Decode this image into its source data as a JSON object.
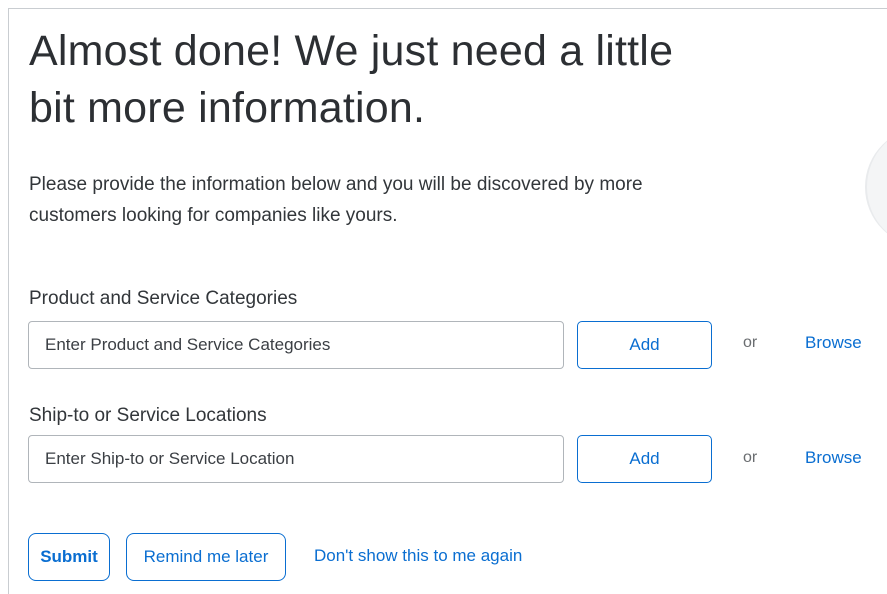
{
  "title": "Almost done! We just need a little bit more information.",
  "description": "Please provide the information below and you will be discovered by more customers looking for companies like yours.",
  "categories": {
    "label": "Product and Service Categories",
    "placeholder": "Enter Product and Service Categories",
    "add_label": "Add",
    "or_label": "or",
    "browse_label": "Browse"
  },
  "locations": {
    "label": "Ship-to or Service Locations",
    "placeholder": "Enter Ship-to or Service Location",
    "add_label": "Add",
    "or_label": "or",
    "browse_label": "Browse"
  },
  "actions": {
    "submit_label": "Submit",
    "remind_label": "Remind me later",
    "dont_show_label": "Don't show this to me again"
  },
  "colors": {
    "accent": "#0a6ed1",
    "text": "#32363a",
    "border": "#b0b5ba"
  }
}
